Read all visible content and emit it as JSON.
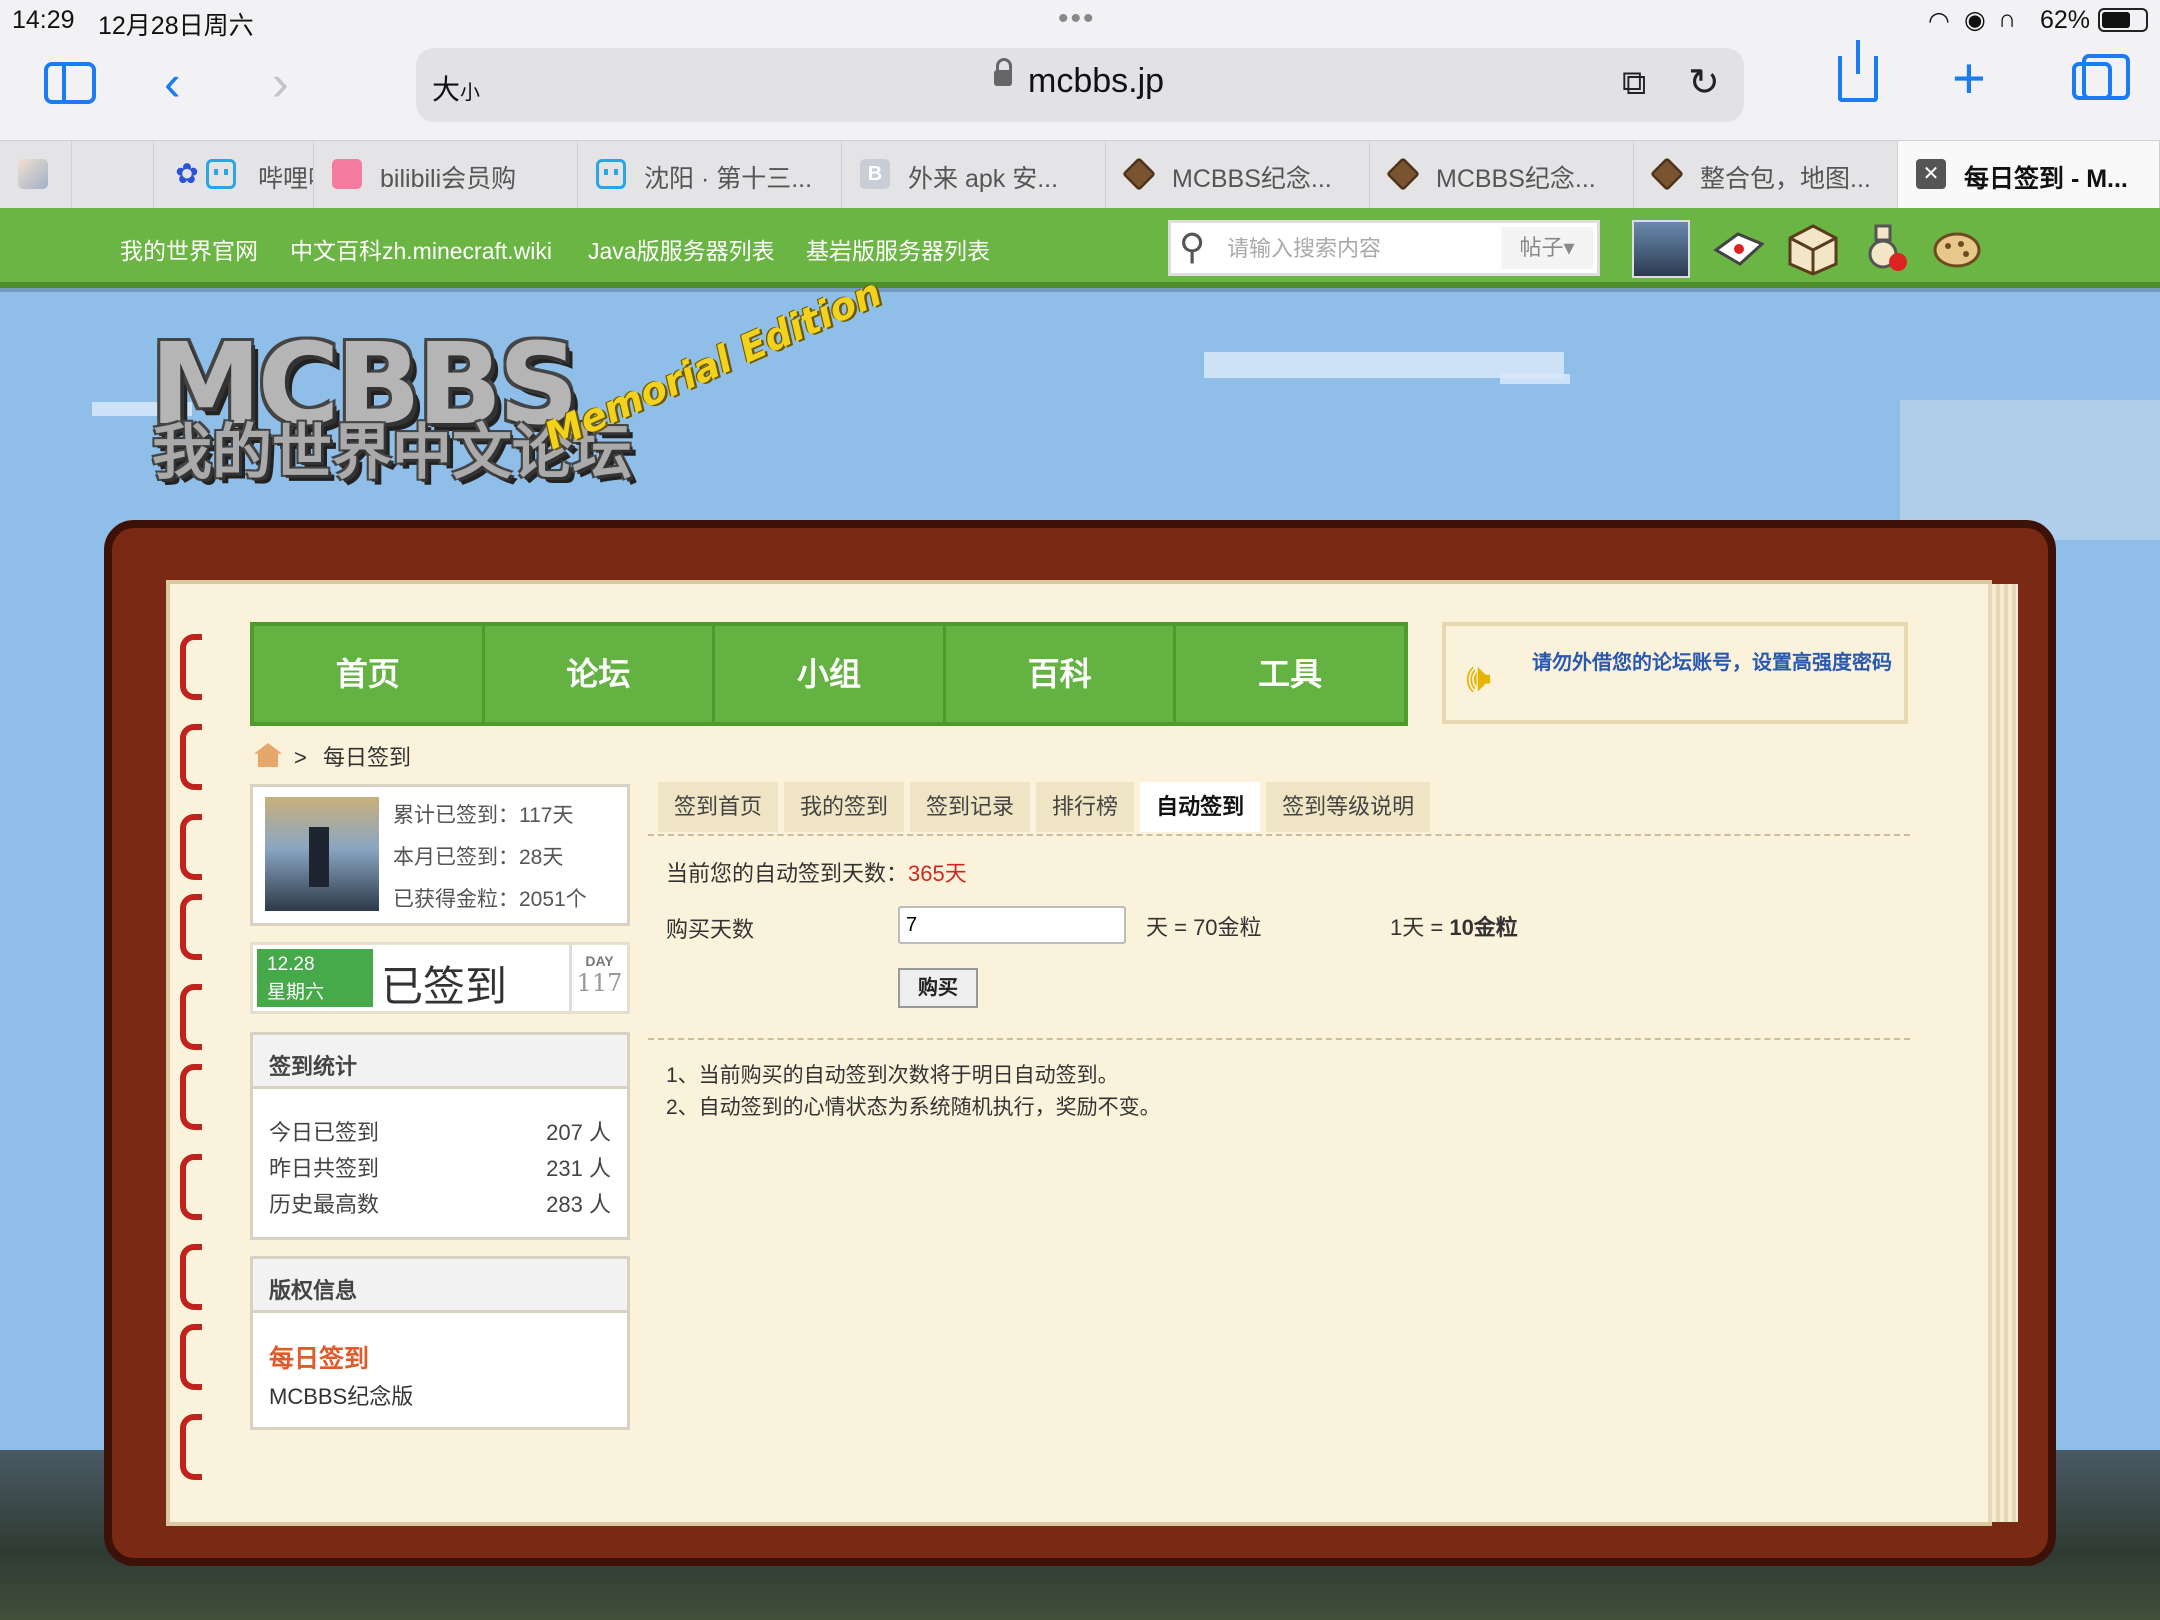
{
  "status": {
    "time": "14:29",
    "date": "12月28日周六",
    "battery": "62%"
  },
  "toolbar": {
    "text_size": "大",
    "text_size_small": "小",
    "url": "mcbbs.jp"
  },
  "tabs": [
    {
      "label": "",
      "icon": "avatar-icon"
    },
    {
      "label": "",
      "icon": "paw-icon"
    },
    {
      "label": "哔哩哔",
      "icon": "bilibili-icon"
    },
    {
      "label": "bilibili会员购",
      "icon": "bag-icon"
    },
    {
      "label": "沈阳 · 第十三...",
      "icon": "bilibili-icon"
    },
    {
      "label": "外来 apk 安...",
      "icon": "b-icon"
    },
    {
      "label": "MCBBS纪念...",
      "icon": "box-icon"
    },
    {
      "label": "MCBBS纪念...",
      "icon": "box-icon"
    },
    {
      "label": "整合包，地图...",
      "icon": "box-icon"
    },
    {
      "label": "每日签到 - M...",
      "icon": "close-tab-icon"
    }
  ],
  "greenbar": {
    "links": [
      "我的世界官网",
      "中文百科zh.minecraft.wiki",
      "Java版服务器列表",
      "基岩版服务器列表"
    ],
    "search_placeholder": "请输入搜索内容",
    "search_type": "帖子▾"
  },
  "logo": {
    "big": "MCBBS",
    "cn": "我的世界中文论坛",
    "edition": "Memorial Edition"
  },
  "nav": [
    "首页",
    "论坛",
    "小组",
    "百科",
    "工具"
  ],
  "notice": "请勿外借您的论坛账号，设置高强度密码",
  "breadcrumb": {
    "sep": ">",
    "current": "每日签到"
  },
  "profile": {
    "total": "累计已签到：117天",
    "month": "本月已签到：28天",
    "gold": "已获得金粒：2051个"
  },
  "signed": {
    "date": "12.28",
    "weekday": "星期六",
    "status": "已签到",
    "day_label": "DAY",
    "day_num": "117"
  },
  "stats": {
    "title": "签到统计",
    "rows": [
      {
        "label": "今日已签到",
        "value": "207 人"
      },
      {
        "label": "昨日共签到",
        "value": "231 人"
      },
      {
        "label": "历史最高数",
        "value": "283 人"
      }
    ]
  },
  "copyright": {
    "title": "版权信息",
    "name": "每日签到",
    "org": "MCBBS纪念版"
  },
  "subtabs": [
    "签到首页",
    "我的签到",
    "签到记录",
    "排行榜",
    "自动签到",
    "签到等级说明"
  ],
  "auto": {
    "current_label": "当前您的自动签到天数：",
    "current_value": "365天",
    "buy_label": "购买天数",
    "buy_value": "7",
    "cost": "天 = 70金粒",
    "rate_label": "1天 =",
    "rate_value": "10金粒",
    "buy_button": "购买",
    "notes": [
      "1、当前购买的自动签到次数将于明日自动签到。",
      "2、自动签到的心情状态为系统随机执行，奖励不变。"
    ]
  }
}
